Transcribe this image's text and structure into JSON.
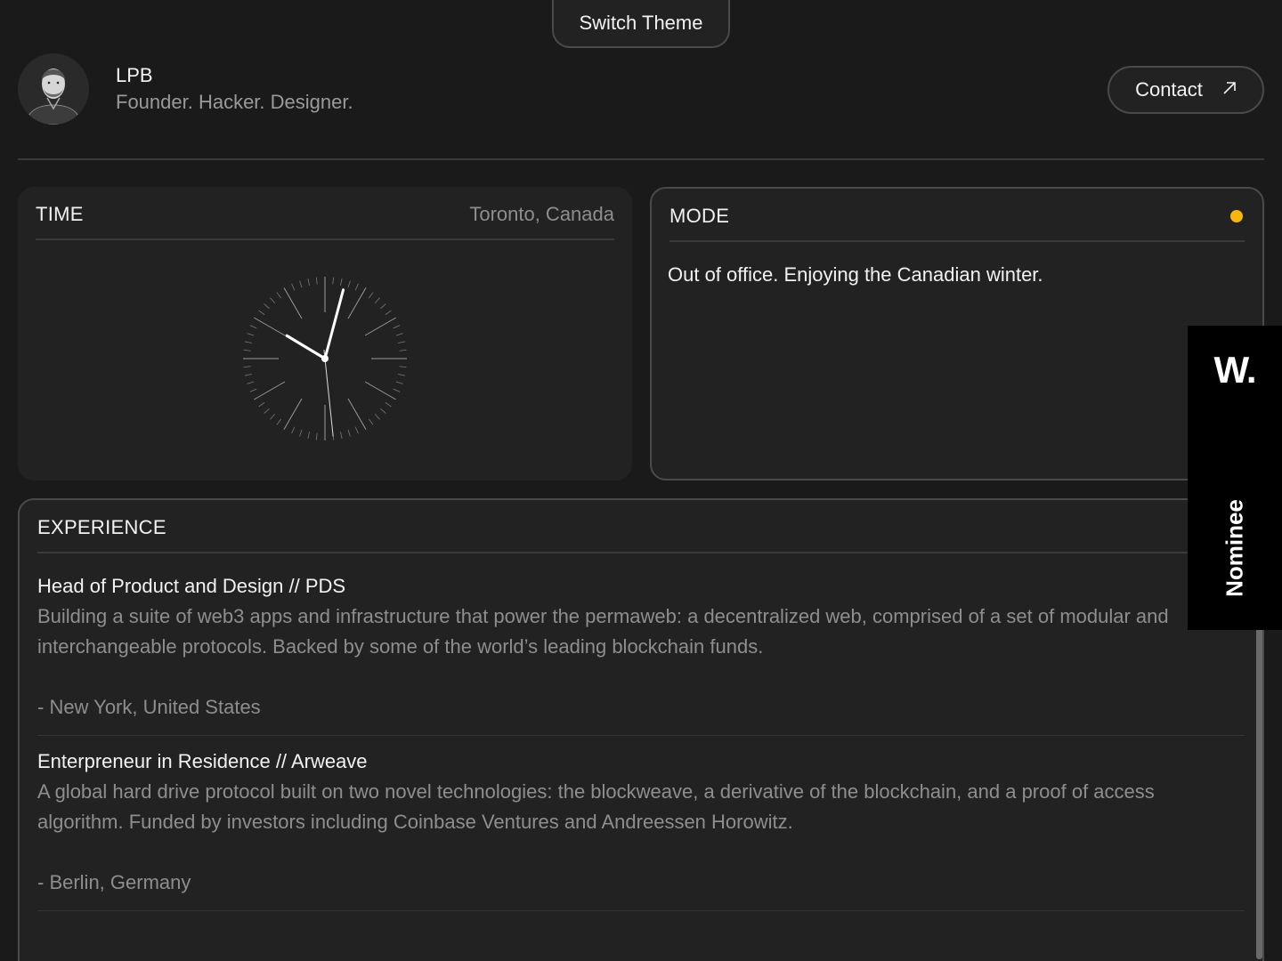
{
  "header": {
    "switch_theme_label": "Switch Theme",
    "name": "LPB",
    "tagline": "Founder. Hacker. Designer.",
    "contact_label": "Contact",
    "contact_icon": "arrow-up-right-icon"
  },
  "time_card": {
    "title": "TIME",
    "location": "Toronto, Canada",
    "clock": {
      "hour": 10,
      "minute": 2,
      "second": 29
    }
  },
  "mode_card": {
    "title": "MODE",
    "status_color": "#f5b70f",
    "message": "Out of office. Enjoying the Canadian winter."
  },
  "experience": {
    "title": "EXPERIENCE",
    "items": [
      {
        "title": "Head of Product and Design // PDS",
        "description": "Building a suite of web3 apps and infrastructure that power the permaweb: a decentralized web, comprised of a set of modular and interchangeable protocols. Backed by some of the world’s leading blockchain funds.",
        "location": "- New York, United States"
      },
      {
        "title": "Enterpreneur in Residence // Arweave",
        "description": "A global hard drive protocol built on two novel technologies: the blockweave, a derivative of the blockchain, and a proof of access algorithm. Funded by investors including Coinbase Ventures and Andreessen Horowitz.",
        "location": "- Berlin, Germany"
      }
    ]
  },
  "award_badge": {
    "logo": "W.",
    "label": "Nominee"
  }
}
